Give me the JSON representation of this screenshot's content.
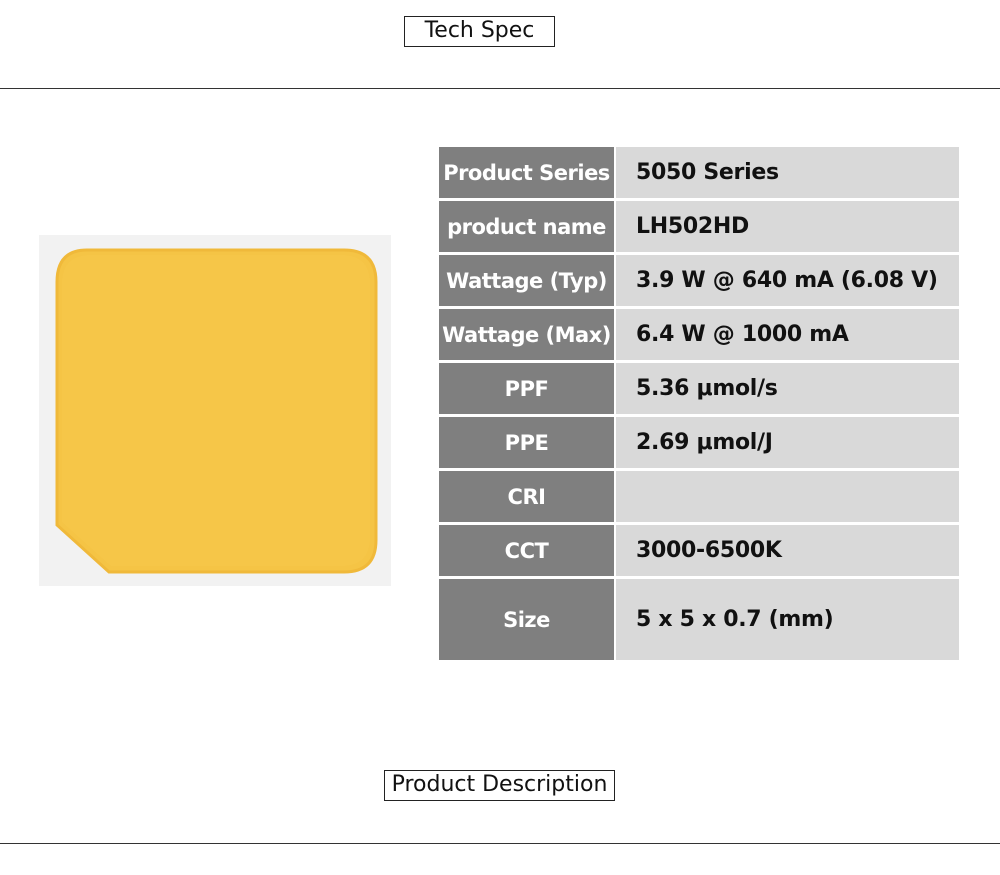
{
  "tech_spec": {
    "title": "Tech Spec"
  },
  "spec": {
    "rows": [
      {
        "label": "Product Series",
        "value": "5050 Series"
      },
      {
        "label": "product name",
        "value": "LH502HD"
      },
      {
        "label": "Wattage (Typ)",
        "value": "3.9 W @ 640 mA (6.08 V)"
      },
      {
        "label": "Wattage (Max)",
        "value": "6.4 W @ 1000 mA"
      },
      {
        "label": "PPF",
        "value": "5.36 μmol/s"
      },
      {
        "label": "PPE",
        "value": "2.69 μmol/J"
      },
      {
        "label": "CRI",
        "value": ""
      },
      {
        "label": "CCT",
        "value": "3000-6500K"
      },
      {
        "label": "Size",
        "value": "5 x 5 x 0.7 (mm)"
      }
    ]
  },
  "product_description": {
    "title": "Product Description"
  },
  "colors": {
    "label_bg": "#7f7f7f",
    "value_bg": "#d9d9d9",
    "led_phosphor": "#f6c64a",
    "led_substrate": "#f2f2f2"
  }
}
